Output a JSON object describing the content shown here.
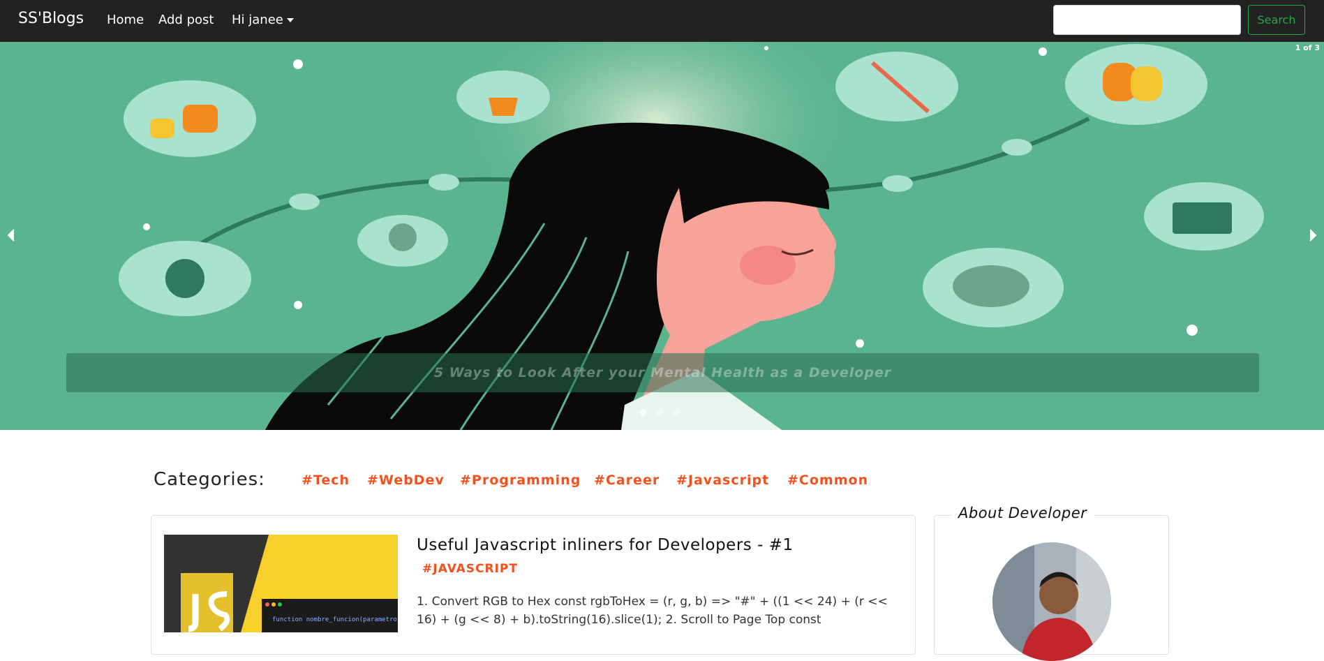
{
  "navbar": {
    "brand": "SS'Blogs",
    "links": [
      "Home",
      "Add post"
    ],
    "user_menu": "Hi janee",
    "search_placeholder": "",
    "search_button": "Search"
  },
  "carousel": {
    "counter": "1 of 3",
    "caption": "5 Ways to Look After your Mental Health as a Developer",
    "indicator_count": 3,
    "active_index": 0
  },
  "categories": {
    "title": "Categories:",
    "items": [
      "#Tech",
      "#WebDev",
      "#Programming",
      "#Career",
      "#Javascript",
      "#Common"
    ]
  },
  "post": {
    "title": "Useful Javascript inliners for Developers - #1",
    "tag": "#JAVASCRIPT",
    "excerpt": "1. Convert RGB to Hex const rgbToHex = (r, g, b) => \"#\" + ((1 << 24) + (r << 16) + (g << 8) + b).toString(16).slice(1); 2. Scroll to Page Top const",
    "thumb_code": "function nombre_funcion(parametros){"
  },
  "about": {
    "title": "About Developer"
  },
  "colors": {
    "navbar": "#222222",
    "accent": "#f4511e",
    "search_button": "#28a745",
    "carousel_bg": "#5bb490"
  }
}
